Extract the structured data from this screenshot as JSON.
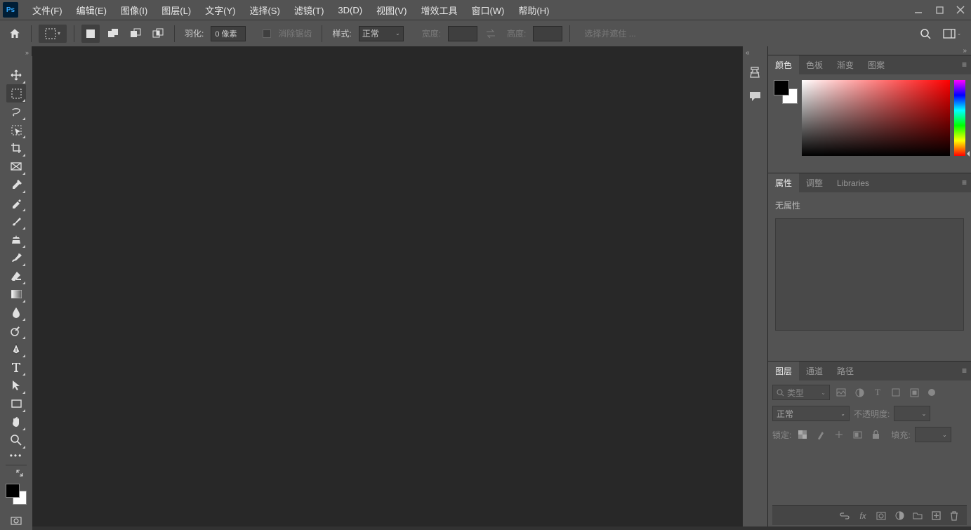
{
  "menus": [
    "文件(F)",
    "编辑(E)",
    "图像(I)",
    "图层(L)",
    "文字(Y)",
    "选择(S)",
    "滤镜(T)",
    "3D(D)",
    "视图(V)",
    "增效工具",
    "窗口(W)",
    "帮助(H)"
  ],
  "optbar": {
    "feather_label": "羽化:",
    "feather_value": "0 像素",
    "antialias_label": "消除锯齿",
    "style_label": "样式:",
    "style_value": "正常",
    "width_label": "宽度:",
    "height_label": "高度:",
    "mask_label": "选择并遮住 ..."
  },
  "color_panel": {
    "tabs": [
      "颜色",
      "色板",
      "渐变",
      "图案"
    ],
    "active": 0
  },
  "props_panel": {
    "tabs": [
      "属性",
      "调整",
      "Libraries"
    ],
    "active": 0,
    "empty_text": "无属性"
  },
  "layers_panel": {
    "tabs": [
      "图层",
      "通道",
      "路径"
    ],
    "active": 0,
    "search_placeholder": "类型",
    "blend_mode": "正常",
    "opacity_label": "不透明度:",
    "fill_label": "填充:",
    "lock_label": "锁定:"
  }
}
